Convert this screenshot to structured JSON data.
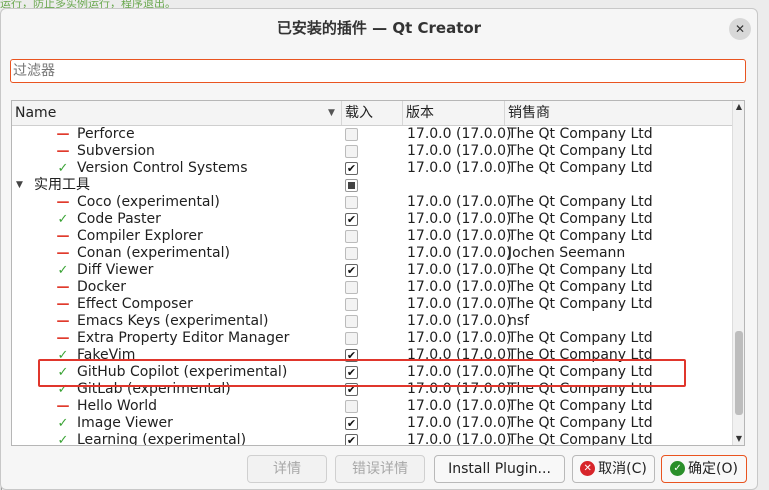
{
  "background": {
    "top_text": "运行，防止多实例运行，程序退出。",
    "bottom_text": "[]() {"
  },
  "dialog": {
    "title": "已安装的插件 — Qt Creator",
    "close_glyph": "✕"
  },
  "filter": {
    "placeholder": "过滤器",
    "value": ""
  },
  "table": {
    "headers": {
      "name": "Name",
      "load": "载入",
      "version": "版本",
      "vendor": "销售商"
    },
    "sort_indicator": "▼",
    "rows": [
      {
        "type": "plugin",
        "enabled": false,
        "name": "Perforce",
        "loaded": false,
        "version": "17.0.0 (17.0.0)",
        "vendor": "The Qt Company Ltd"
      },
      {
        "type": "plugin",
        "enabled": false,
        "name": "Subversion",
        "loaded": false,
        "version": "17.0.0 (17.0.0)",
        "vendor": "The Qt Company Ltd"
      },
      {
        "type": "plugin",
        "enabled": true,
        "name": "Version Control Systems",
        "loaded": true,
        "version": "17.0.0 (17.0.0)",
        "vendor": "The Qt Company Ltd"
      },
      {
        "type": "category",
        "name": "实用工具",
        "expanded": true,
        "partial": true
      },
      {
        "type": "plugin",
        "enabled": false,
        "name": "Coco (experimental)",
        "loaded": false,
        "version": "17.0.0 (17.0.0)",
        "vendor": "The Qt Company Ltd"
      },
      {
        "type": "plugin",
        "enabled": true,
        "name": "Code Paster",
        "loaded": true,
        "version": "17.0.0 (17.0.0)",
        "vendor": "The Qt Company Ltd"
      },
      {
        "type": "plugin",
        "enabled": false,
        "name": "Compiler Explorer",
        "loaded": false,
        "version": "17.0.0 (17.0.0)",
        "vendor": "The Qt Company Ltd"
      },
      {
        "type": "plugin",
        "enabled": false,
        "name": "Conan (experimental)",
        "loaded": false,
        "version": "17.0.0 (17.0.0)",
        "vendor": "Jochen Seemann"
      },
      {
        "type": "plugin",
        "enabled": true,
        "name": "Diff Viewer",
        "loaded": true,
        "version": "17.0.0 (17.0.0)",
        "vendor": "The Qt Company Ltd"
      },
      {
        "type": "plugin",
        "enabled": false,
        "name": "Docker",
        "loaded": false,
        "version": "17.0.0 (17.0.0)",
        "vendor": "The Qt Company Ltd"
      },
      {
        "type": "plugin",
        "enabled": false,
        "name": "Effect Composer",
        "loaded": false,
        "version": "17.0.0 (17.0.0)",
        "vendor": "The Qt Company Ltd"
      },
      {
        "type": "plugin",
        "enabled": false,
        "name": "Emacs Keys (experimental)",
        "loaded": false,
        "version": "17.0.0 (17.0.0)",
        "vendor": "nsf"
      },
      {
        "type": "plugin",
        "enabled": false,
        "name": "Extra Property Editor Manager",
        "loaded": false,
        "version": "17.0.0 (17.0.0)",
        "vendor": "The Qt Company Ltd"
      },
      {
        "type": "plugin",
        "enabled": true,
        "name": "FakeVim",
        "loaded": true,
        "version": "17.0.0 (17.0.0)",
        "vendor": "The Qt Company Ltd"
      },
      {
        "type": "plugin",
        "enabled": true,
        "name": "GitHub Copilot (experimental)",
        "loaded": true,
        "version": "17.0.0 (17.0.0)",
        "vendor": "The Qt Company Ltd"
      },
      {
        "type": "plugin",
        "enabled": true,
        "name": "GitLab (experimental)",
        "loaded": true,
        "version": "17.0.0 (17.0.0)",
        "vendor": "The Qt Company Ltd"
      },
      {
        "type": "plugin",
        "enabled": false,
        "name": "Hello World",
        "loaded": false,
        "version": "17.0.0 (17.0.0)",
        "vendor": "The Qt Company Ltd"
      },
      {
        "type": "plugin",
        "enabled": true,
        "name": "Image Viewer",
        "loaded": true,
        "version": "17.0.0 (17.0.0)",
        "vendor": "The Qt Company Ltd"
      },
      {
        "type": "plugin",
        "enabled": true,
        "name": "Learning (experimental)",
        "loaded": true,
        "version": "17.0.0 (17.0.0)",
        "vendor": "The Qt Company Ltd"
      }
    ]
  },
  "buttons": {
    "details": "详情",
    "error_details": "错误详情",
    "install": "Install Plugin...",
    "cancel": "取消(C)",
    "ok": "确定(O)"
  },
  "icons": {
    "enabled_mark": "✓",
    "disabled_mark": "—",
    "expanded_arrow": "▼",
    "check_glyph": "✔",
    "scroll_up": "▲",
    "scroll_down": "▼",
    "cancel_icon": "✕",
    "ok_icon": "✓"
  },
  "colors": {
    "accent": "#e95420",
    "enabled_mark": "#3aa335",
    "disabled_mark": "#e03a2c",
    "highlight_box": "#e0362c"
  }
}
